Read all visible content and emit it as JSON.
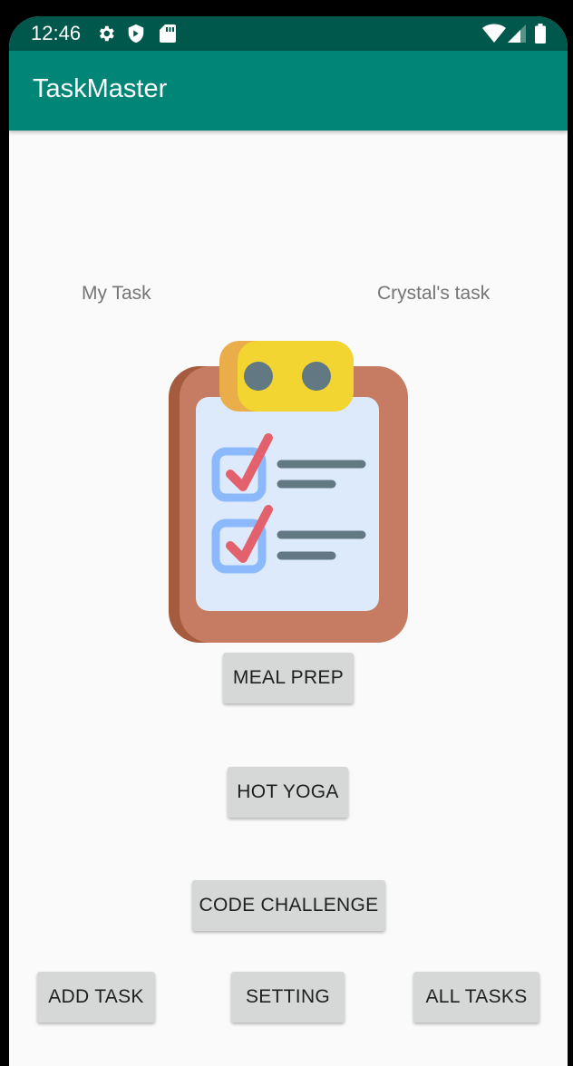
{
  "status_bar": {
    "time": "12:46",
    "left_icons": [
      "gear-icon",
      "shield-icon",
      "sd-card-icon"
    ],
    "right_icons": [
      "wifi-icon",
      "signal-icon",
      "battery-icon"
    ]
  },
  "app_bar": {
    "title": "TaskMaster"
  },
  "labels": {
    "my_task": "My Task",
    "crystals_task": "Crystal's task"
  },
  "image": {
    "icon": "clipboard-checklist-icon"
  },
  "task_buttons": {
    "meal_prep": "MEAL PREP",
    "hot_yoga": "HOT YOGA",
    "code_challenge": "CODE CHALLENGE"
  },
  "bottom_buttons": {
    "add_task": "ADD TASK",
    "setting": "SETTING",
    "all_tasks": "ALL TASKS"
  },
  "colors": {
    "status_bar": "#00574b",
    "app_bar": "#008577",
    "background": "#fafafa",
    "button": "#d6d7d7"
  }
}
